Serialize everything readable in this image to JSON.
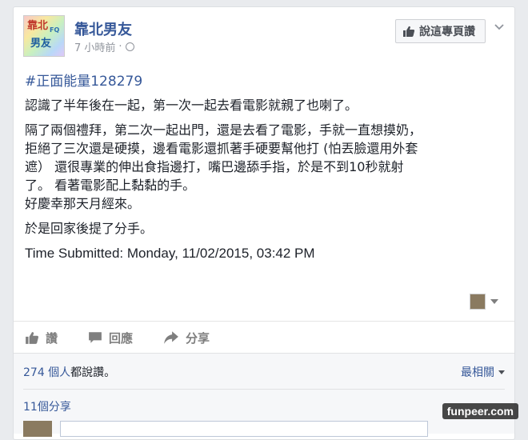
{
  "page": {
    "name": "靠北男友",
    "avatar_text": [
      "靠北",
      "男友"
    ],
    "avatar_fq": "FQ",
    "timestamp": "7 小時前",
    "meta_sep": "·",
    "like_page_label": "說這專頁讚"
  },
  "post": {
    "hashtag": "#正面能量128279",
    "paragraphs": [
      [
        "認識了半年後在一起，第一次一起去看電影就親了也喇了。"
      ],
      [
        "隔了兩個禮拜，第二次一起出門，還是去看了電影，手就一直想摸奶，",
        "拒絕了三次還是硬摸，邊看電影還抓著手硬要幫他打 (怕丟臉還用外套",
        "遮） 還很專業的伸出食指邊打，嘴巴邊舔手指，於是不到10秒就射",
        "了。 看著電影配上黏黏的手。",
        "好慶幸那天月經來。"
      ],
      [
        "於是回家後提了分手。"
      ]
    ],
    "time_submitted": "Time Submitted: Monday, 11/02/2015, 03:42 PM"
  },
  "actions": {
    "like": "讚",
    "comment": "回應",
    "share": "分享"
  },
  "feedback": {
    "likes_count_link": "274 個人",
    "likes_suffix": "都說讚。",
    "sort_label": "最相關",
    "shares_label": "11個分享"
  },
  "watermark": "funpeer.com",
  "colors": {
    "link": "#365899",
    "text": "#1d2129",
    "muted": "#90949c",
    "action_gray": "#7f7f7f"
  }
}
